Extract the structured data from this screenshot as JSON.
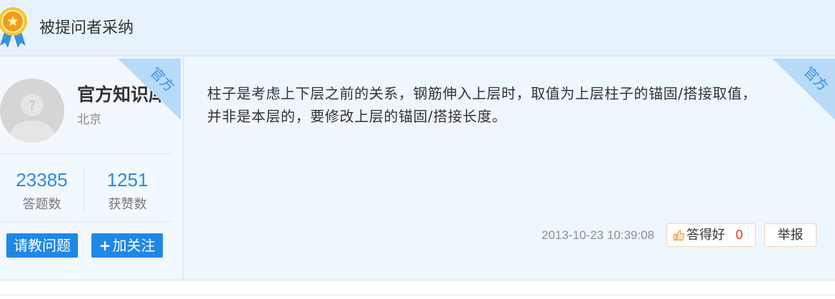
{
  "header": {
    "title": "被提问者采纳",
    "badge_icon": "medal-icon"
  },
  "user": {
    "avatar_icon": "default-avatar-icon",
    "name": "官方知识库",
    "location": "北京",
    "ribbon": "官方"
  },
  "stats": [
    {
      "value": "23385",
      "label": "答题数"
    },
    {
      "value": "1251",
      "label": "获赞数"
    }
  ],
  "buttons": {
    "ask": "请教问题",
    "follow_plus": "+",
    "follow": "加关注"
  },
  "answer": {
    "ribbon": "官方",
    "lines": [
      "柱子是考虑上下层之前的关系，钢筋伸入上层时，取值为上层柱子的锚固/搭接取值，",
      "并非是本层的，要修改上层的锚固/搭接长度。"
    ],
    "timestamp": "2013-10-23 10:39:08",
    "like_icon": "thumbs-up-icon",
    "like_label": "答得好",
    "like_count": "0",
    "report_label": "举报"
  },
  "colors": {
    "header_bg": "#e7f2fc",
    "panel_bg": "#eef6fe",
    "ribbon_bg": "#b7daf8",
    "ribbon_text": "#3a8fe4",
    "stat_value": "#2f88e0",
    "button_blue": "#1f87e5",
    "like_count": "#e0382b"
  }
}
